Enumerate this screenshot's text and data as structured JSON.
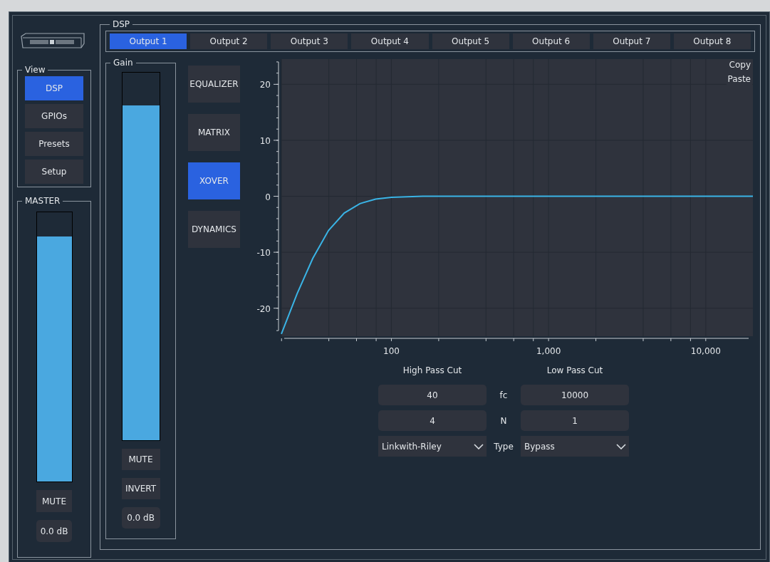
{
  "view": {
    "title": "View",
    "items": [
      {
        "label": "DSP",
        "selected": true
      },
      {
        "label": "GPIOs",
        "selected": false
      },
      {
        "label": "Presets",
        "selected": false
      },
      {
        "label": "Setup",
        "selected": false
      }
    ]
  },
  "master": {
    "title": "MASTER",
    "level": 0.91,
    "mute": "MUTE",
    "gain": "0.0 dB"
  },
  "dsp": {
    "title": "DSP",
    "outputs": [
      {
        "label": "Output 1",
        "selected": true
      },
      {
        "label": "Output 2",
        "selected": false
      },
      {
        "label": "Output 3",
        "selected": false
      },
      {
        "label": "Output 4",
        "selected": false
      },
      {
        "label": "Output 5",
        "selected": false
      },
      {
        "label": "Output 6",
        "selected": false
      },
      {
        "label": "Output 7",
        "selected": false
      },
      {
        "label": "Output 8",
        "selected": false
      }
    ],
    "gain": {
      "title": "Gain",
      "level": 0.91,
      "buttons": [
        "MUTE",
        "INVERT"
      ],
      "value": "0.0 dB"
    },
    "modules": [
      {
        "label": "EQUALIZER",
        "selected": false
      },
      {
        "label": "MATRIX",
        "selected": false
      },
      {
        "label": "XOVER",
        "selected": true
      },
      {
        "label": "DYNAMICS",
        "selected": false
      }
    ],
    "chart": {
      "copy": "Copy",
      "paste": "Paste",
      "chart_data": {
        "type": "line",
        "grid": true,
        "ylim": [
          -25,
          24.5
        ],
        "yticks": [
          -20,
          -10,
          0,
          10,
          20
        ],
        "categories": [
          null,
          null,
          null,
          null,
          null,
          null,
          null,
          "100",
          null,
          null,
          null,
          null,
          null,
          null,
          null,
          null,
          null,
          "1,000",
          null,
          null,
          null,
          null,
          null,
          null,
          null,
          null,
          null,
          "10,000",
          null,
          null,
          null
        ],
        "series": [
          {
            "color": "#3ab4e6",
            "values": [
              -24.6,
              -17.4,
              -11.1,
              -6.1,
              -3,
              -1.3,
              -0.5,
              -0.2,
              -0.1,
              0,
              0,
              0,
              0,
              0,
              0,
              0,
              0,
              0,
              0,
              0,
              0,
              0,
              0,
              0,
              0,
              0,
              0,
              0,
              0,
              0,
              0
            ]
          }
        ]
      }
    },
    "crossover": {
      "columns": [
        "High Pass Cut",
        "Low Pass Cut"
      ],
      "rows": [
        {
          "label": "fc",
          "kind": "number",
          "high": "40",
          "low": "10000"
        },
        {
          "label": "N",
          "kind": "number",
          "high": "4",
          "low": "1"
        },
        {
          "label": "Type",
          "kind": "select",
          "high": "Linkwith-Riley",
          "low": "Bypass"
        }
      ]
    }
  }
}
